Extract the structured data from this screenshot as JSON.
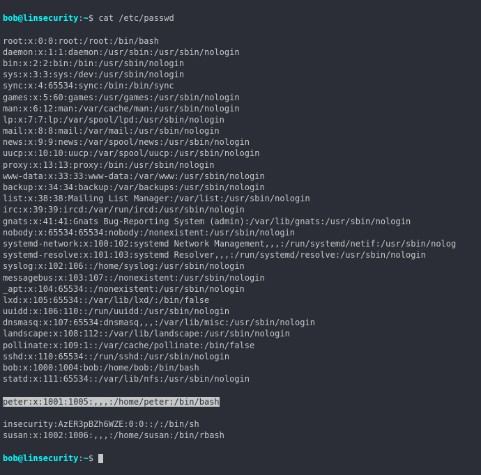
{
  "prompt": {
    "userhost": "bob@linsecurity",
    "sep": ":",
    "path": "~",
    "dollar": "$ "
  },
  "command": "cat /etc/passwd",
  "lines": [
    "root:x:0:0:root:/root:/bin/bash",
    "daemon:x:1:1:daemon:/usr/sbin:/usr/sbin/nologin",
    "bin:x:2:2:bin:/bin:/usr/sbin/nologin",
    "sys:x:3:3:sys:/dev:/usr/sbin/nologin",
    "sync:x:4:65534:sync:/bin:/bin/sync",
    "games:x:5:60:games:/usr/games:/usr/sbin/nologin",
    "man:x:6:12:man:/var/cache/man:/usr/sbin/nologin",
    "lp:x:7:7:lp:/var/spool/lpd:/usr/sbin/nologin",
    "mail:x:8:8:mail:/var/mail:/usr/sbin/nologin",
    "news:x:9:9:news:/var/spool/news:/usr/sbin/nologin",
    "uucp:x:10:10:uucp:/var/spool/uucp:/usr/sbin/nologin",
    "proxy:x:13:13:proxy:/bin:/usr/sbin/nologin",
    "www-data:x:33:33:www-data:/var/www:/usr/sbin/nologin",
    "backup:x:34:34:backup:/var/backups:/usr/sbin/nologin",
    "list:x:38:38:Mailing List Manager:/var/list:/usr/sbin/nologin",
    "irc:x:39:39:ircd:/var/run/ircd:/usr/sbin/nologin",
    "gnats:x:41:41:Gnats Bug-Reporting System (admin):/var/lib/gnats:/usr/sbin/nologin",
    "nobody:x:65534:65534:nobody:/nonexistent:/usr/sbin/nologin",
    "systemd-network:x:100:102:systemd Network Management,,,:/run/systemd/netif:/usr/sbin/nolog",
    "systemd-resolve:x:101:103:systemd Resolver,,,:/run/systemd/resolve:/usr/sbin/nologin",
    "syslog:x:102:106::/home/syslog:/usr/sbin/nologin",
    "messagebus:x:103:107::/nonexistent:/usr/sbin/nologin",
    "_apt:x:104:65534::/nonexistent:/usr/sbin/nologin",
    "lxd:x:105:65534::/var/lib/lxd/:/bin/false",
    "uuidd:x:106:110::/run/uuidd:/usr/sbin/nologin",
    "dnsmasq:x:107:65534:dnsmasq,,,:/var/lib/misc:/usr/sbin/nologin",
    "landscape:x:108:112::/var/lib/landscape:/usr/sbin/nologin",
    "pollinate:x:109:1::/var/cache/pollinate:/bin/false",
    "sshd:x:110:65534::/run/sshd:/usr/sbin/nologin",
    "bob:x:1000:1004:bob:/home/bob:/bin/bash",
    "statd:x:111:65534::/var/lib/nfs:/usr/sbin/nologin"
  ],
  "highlighted_line": "peter:x:1001:1005:,,,:/home/peter:/bin/bash",
  "lines_after": [
    "insecurity:AzER3pBZh6WZE:0:0::/:/bin/sh",
    "susan:x:1002:1006:,,,:/home/susan:/bin/rbash"
  ]
}
